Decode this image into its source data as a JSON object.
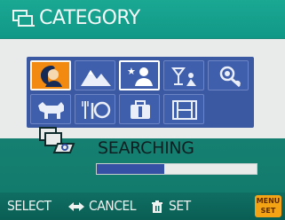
{
  "header": {
    "title": "CATEGORY",
    "icon": "category-icon"
  },
  "categories": [
    {
      "icon": "portrait-icon",
      "selected": true
    },
    {
      "icon": "scenery-icon"
    },
    {
      "icon": "night-portrait-icon",
      "current": true
    },
    {
      "icon": "food-party-icon"
    },
    {
      "icon": "baby-icon"
    },
    {
      "icon": "pet-icon"
    },
    {
      "icon": "cuisine-icon"
    },
    {
      "icon": "travel-icon"
    },
    {
      "icon": "video-clip-icon"
    }
  ],
  "status": {
    "text": "SEARCHING",
    "progress": 0.42
  },
  "footer": {
    "select_label": "SELECT",
    "cancel_label": "CANCEL",
    "set_label": "SET",
    "menu_badge_top": "MENU",
    "menu_badge_bottom": "SET"
  },
  "colors": {
    "title_bg": "#10a08c",
    "panel_bg": "#e9ebea",
    "grid_bg": "#3b58a2",
    "selected": "#f28a12",
    "progress_fill": "#3451a6",
    "footer_bg": "#0d6a5f",
    "menu_badge": "#f3a313"
  }
}
